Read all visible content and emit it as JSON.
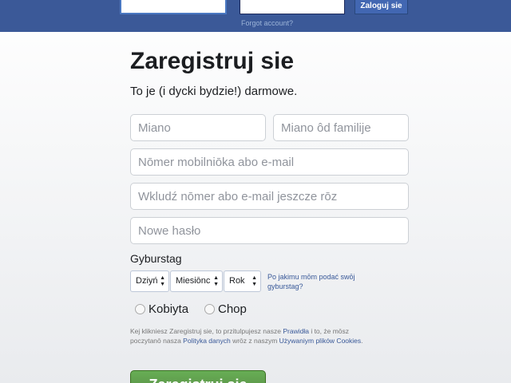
{
  "header": {
    "login_button": "Zaloguj sie",
    "forgot_account": "Forgot account?"
  },
  "signup": {
    "title": "Zaregistruj sie",
    "subtitle": "To je (i dycki bydzie!) darmowe.",
    "first_name_placeholder": "Miano",
    "last_name_placeholder": "Miano ôd familije",
    "contact_placeholder": "Nōmer mobilniōka abo e-mail",
    "contact_repeat_placeholder": "Wkludź nōmer abo e-mail jeszcze rōz",
    "password_placeholder": "Nowe hasło",
    "birthday_label": "Gyburstag",
    "day_select": "Dziyń",
    "month_select": "Miesiōnc",
    "year_select": "Rok",
    "why_birthday": "Po jakimu mōm podać swōj gyburstag?",
    "gender_female": "Kobiyta",
    "gender_male": "Chop",
    "terms_part1": "Kej klikniesz Zaregistruj sie, to przitulpujesz nasze ",
    "terms_link1": "Prawidła",
    "terms_part2": " i to, że mōsz poczytanō nasza ",
    "terms_link2": "Polityka danych",
    "terms_part3": " wrōz z naszym ",
    "terms_link3": "Używaniym plików Cookies",
    "terms_part4": ".",
    "submit_button": "Zaregistruj sie"
  },
  "colors": {
    "topbar": "#3b5998",
    "link": "#385898",
    "submit": "#5fa04b"
  }
}
